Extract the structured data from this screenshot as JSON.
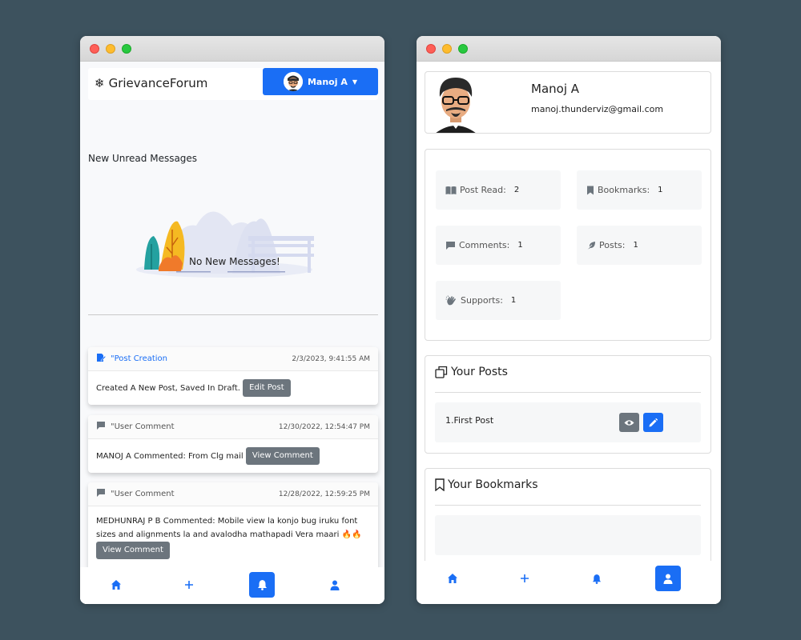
{
  "left": {
    "brand": "GrievanceForum",
    "user_button": {
      "name": "Manoj A"
    },
    "section_title": "New Unread Messages",
    "empty_state": "No New Messages!",
    "notifications": [
      {
        "icon": "edit-document-icon",
        "type": "\"Post Creation",
        "time": "2/3/2023, 9:41:55 AM",
        "text": "Created A New Post, Saved In Draft.",
        "button": "Edit Post",
        "accent": "#1a6ef5"
      },
      {
        "icon": "comment-icon",
        "type": "\"User Comment",
        "time": "12/30/2022, 12:54:47 PM",
        "text": "MANOJ A Commented: From Clg mail",
        "button": "View Comment",
        "accent": "#555555"
      },
      {
        "icon": "comment-icon",
        "type": "\"User Comment",
        "time": "12/28/2022, 12:59:25 PM",
        "text": "MEDHUNRAJ P B Commented: Mobile view la konjo bug iruku font sizes and alignments la and avalodha mathapadi Vera maari 🔥🔥",
        "button": "View Comment",
        "accent": "#555555"
      }
    ],
    "bottom_nav": [
      "home-icon",
      "plus-icon",
      "bell-icon",
      "user-icon"
    ],
    "active_nav": "bell-icon"
  },
  "right": {
    "profile": {
      "name": "Manoj A",
      "email": "manoj.thunderviz@gmail.com"
    },
    "stats": [
      {
        "icon": "book-open-icon",
        "label": "Post Read:",
        "value": "2"
      },
      {
        "icon": "bookmark-icon",
        "label": "Bookmarks:",
        "value": "1"
      },
      {
        "icon": "comment-icon",
        "label": "Comments:",
        "value": "1"
      },
      {
        "icon": "feather-icon",
        "label": "Posts:",
        "value": "1"
      },
      {
        "icon": "clapping-hands-icon",
        "label": "Supports:",
        "value": "1"
      }
    ],
    "your_posts": {
      "title": "Your Posts",
      "items": [
        {
          "label": "1.First Post"
        }
      ]
    },
    "your_bookmarks": {
      "title": "Your Bookmarks"
    },
    "bottom_nav": [
      "home-icon",
      "plus-icon",
      "bell-icon",
      "user-icon"
    ],
    "active_nav": "user-icon"
  },
  "colors": {
    "primary": "#1a6ef5",
    "secondary": "#6c757d",
    "background": "#3d525e"
  }
}
